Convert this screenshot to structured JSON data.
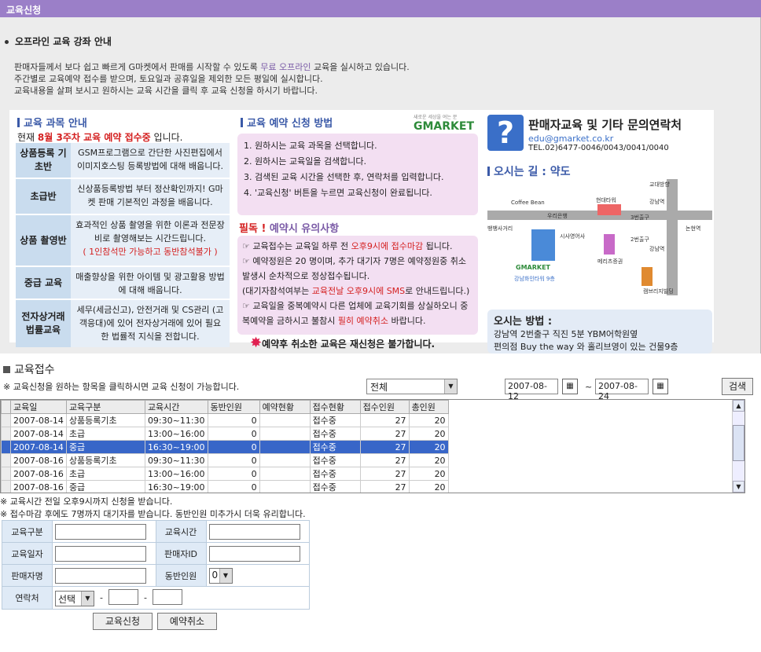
{
  "window": {
    "title": "교육신청"
  },
  "info": {
    "heading": "오프라인 교육 강좌 안내",
    "intro1a": "판매자들께서 보다 쉽고 빠르게 G마켓에서 판매를 시작할 수 있도록 ",
    "intro1b": "무료 오프라인",
    "intro1c": " 교육을 실시하고 있습니다.",
    "intro2": "주간별로 교육예약 접수를 받으며, 토요일과 공휴일을 제외한 모든 평일에 실시합니다.",
    "intro3": "교육내용을 살펴 보시고 원하시는 교육 시간을 클릭 후 교육 신청을 하시기 바랍니다."
  },
  "courses": {
    "title": "교육 과목 안내",
    "now_prefix": "현재 ",
    "now_red": "8월 3주차 교육 예약 접수중",
    "now_suffix": " 입니다.",
    "items": [
      {
        "cat": "상품등록 기초반",
        "desc": "GSM프로그램으로 간단한 사진편집에서 이미지호스팅 등록방법에 대해 배웁니다."
      },
      {
        "cat": "초급반",
        "desc": "신상품등록방법 부터 정산확인까지! G마켓 판매 기본적인 과정을 배웁니다."
      },
      {
        "cat": "상품 촬영반",
        "desc": "효과적인 상품 촬영을 위한 이론과 전문장비로 촬영해보는 시간드립니다.",
        "note": "( 1인참석만 가능하고 동반참석불가 )"
      },
      {
        "cat": "중급 교육",
        "desc": "매출향상을 위한 아이템 및 광고활용 방법에 대해 배웁니다."
      },
      {
        "cat": "전자상거래 법률교육",
        "desc": "세무(세금신고), 안전거래 및 CS관리 (고객응대)에 있어 전자상거래에 있어 필요한 법률적 지식을 전합니다."
      }
    ]
  },
  "howto": {
    "title": "교육 예약 신청 방법",
    "logo": "GMARKET",
    "logo_sub": "새로운 세상을 여는 문",
    "steps": [
      "1. 원하시는 교육 과목을 선택합니다.",
      "2. 원하시는 교육일을 검색합니다.",
      "3. 검색된 교육 시간을 선택한 후, 연락처를 입력합니다.",
      "4. '교육신청' 버튼을 누르면 교육신청이 완료됩니다."
    ],
    "warn_prefix": "필독 !",
    "warn_title": " 예약시 유의사항",
    "warn1a": "☞ 교육접수는 교육일 하루 전 ",
    "warn1b": "오후9시에 접수마감",
    "warn1c": " 됩니다.",
    "warn2": "☞ 예약정원은 20 명이며, 추가 대기자 7명은 예약정원중 취소발생시 순차적으로 정상접수됩니다.",
    "warn3a": "(대기자참석여부는 ",
    "warn3b": "교육전날 오후9시에 SMS",
    "warn3c": "로 안내드립니다.)",
    "warn4a": "☞ 교육일을 중복예약시 다른 업체에 교육기회를 상실하오니 중복예약을 금하시고 불참시 ",
    "warn4b": "필히 예약취소",
    "warn4c": " 바랍니다.",
    "burst": "예약후 취소한 교육은 재신청은 불가합니다."
  },
  "contact": {
    "q": "?",
    "title": "판매자교육 및 기타 문의연락처",
    "email": "edu@gmarket.co.kr",
    "tel": "TEL.02)6477-0046/0043/0041/0040",
    "map_title": "오시는 길 : 약도",
    "map_labels": {
      "l1": "교대방향",
      "l2": "Coffee Bean",
      "l3": "현대타워",
      "l4": "강남역",
      "l5": "우리은행",
      "l6": "3번출구",
      "l7": "뱅뱅사거리",
      "l8": "논현역",
      "l9": "시사영어사",
      "l10": "2번출구",
      "l11": "강남역",
      "l12": "메리츠증권",
      "l13": "GMARKET",
      "l14": "강남화인타워 9층",
      "l15": "캠브리지빌딩"
    },
    "how_title": "오시는 방법 :",
    "how1": "강남역 2번출구 직진 5분 YBM어학원옆",
    "how2": "편의점 Buy the way 와 홀리브영이 있는 건물9층"
  },
  "reception": {
    "title": "교육접수",
    "note": "※ 교육신청을 원하는 항목을 클릭하시면 교육 신청이 가능합니다.",
    "filter_value": "전체",
    "date_from": "2007-08-12",
    "date_to": "2007-08-24",
    "tilde": "~",
    "search_label": "검색",
    "columns": [
      "교육일",
      "교육구분",
      "교육시간",
      "동반인원",
      "예약현황",
      "접수현황",
      "접수인원",
      "총인원"
    ],
    "rows": [
      [
        "2007-08-14",
        "상품등록기초",
        "09:30~11:30",
        "0",
        "",
        "접수중",
        "27",
        "20"
      ],
      [
        "2007-08-14",
        "초급",
        "13:00~16:00",
        "0",
        "",
        "접수중",
        "27",
        "20"
      ],
      [
        "2007-08-14",
        "중급",
        "16:30~19:00",
        "0",
        "",
        "접수중",
        "27",
        "20"
      ],
      [
        "2007-08-16",
        "상품등록기초",
        "09:30~11:30",
        "0",
        "",
        "접수중",
        "27",
        "20"
      ],
      [
        "2007-08-16",
        "초급",
        "13:00~16:00",
        "0",
        "",
        "접수중",
        "27",
        "20"
      ],
      [
        "2007-08-16",
        "중급",
        "16:30~19:00",
        "0",
        "",
        "접수중",
        "27",
        "20"
      ]
    ],
    "selected_row": 2,
    "note2": "※ 교육시간 전일 오후9시까지 신청을 받습니다.",
    "note3": "※ 접수마감 후에도 7명까지 대기자를 받습니다. 동반인원 미추가시 더욱 유리합니다."
  },
  "form": {
    "type_label": "교육구분",
    "time_label": "교육시간",
    "date_label": "교육일자",
    "seller_id_label": "판매자ID",
    "seller_name_label": "판매자명",
    "companions_label": "동반인원",
    "companions_value": "0",
    "contact_label": "연락처",
    "contact_select": "선택",
    "dash": "-",
    "submit_label": "교육신청",
    "cancel_label": "예약취소"
  },
  "colors": {
    "titlebar": "#9b7fc8",
    "accent_blue": "#3b5aa8",
    "accent_red": "#d42020",
    "selected_row": "#3866c8"
  }
}
